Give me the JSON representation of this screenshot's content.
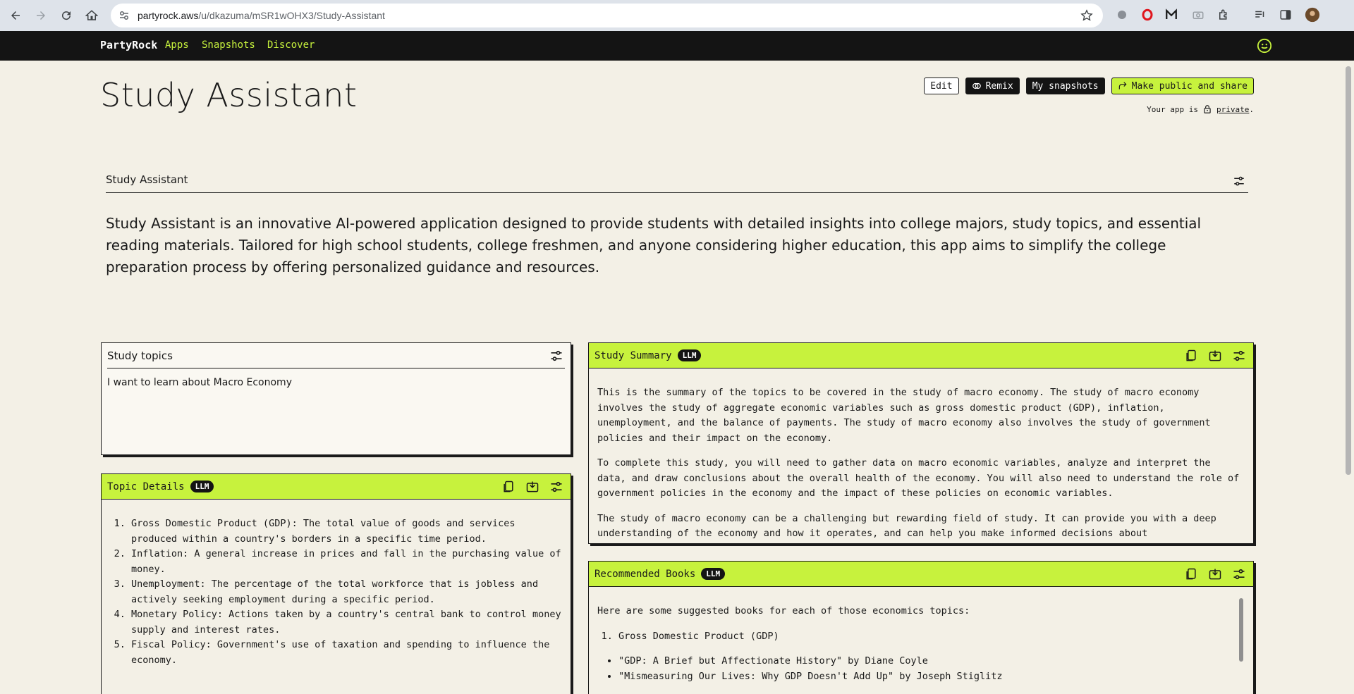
{
  "browser": {
    "url_host": "partyrock.aws",
    "url_path": "/u/dkazuma/mSR1wOHX3/Study-Assistant"
  },
  "nav": {
    "brand": "PartyRock",
    "links": [
      "Apps",
      "Snapshots",
      "Discover"
    ]
  },
  "app": {
    "title": "Study Assistant",
    "actions": {
      "edit": "Edit",
      "remix": "Remix",
      "snapshots": "My snapshots",
      "share": "Make public and share"
    },
    "privacy": {
      "prefix": "Your app is",
      "status": "private",
      "suffix": "."
    }
  },
  "description": {
    "label": "Study Assistant",
    "text": "Study Assistant is an innovative AI-powered application designed to provide students with detailed insights into college majors, study topics, and essential reading materials. Tailored for high school students, college freshmen, and anyone considering higher education, this app aims to simplify the college preparation process by offering personalized guidance and resources."
  },
  "widgets": {
    "study_topics": {
      "label": "Study topics",
      "value": "I want to learn about Macro Economy"
    },
    "topic_details": {
      "label": "Topic Details",
      "badge": "LLM",
      "items": [
        "Gross Domestic Product (GDP): The total value of goods and services produced within a country's borders in a specific time period.",
        "Inflation: A general increase in prices and fall in the purchasing value of money.",
        "Unemployment: The percentage of the total workforce that is jobless and actively seeking employment during a specific period.",
        "Monetary Policy: Actions taken by a country's central bank to control money supply and interest rates.",
        "Fiscal Policy: Government's use of taxation and spending to influence the economy."
      ]
    },
    "study_summary": {
      "label": "Study Summary",
      "badge": "LLM",
      "paragraphs": [
        "This is the summary of the topics to be covered in the study of macro economy. The study of macro economy involves the study of aggregate economic variables such as gross domestic product (GDP), inflation, unemployment, and the balance of payments. The study of macro economy also involves the study of government policies and their impact on the economy.",
        "To complete this study, you will need to gather data on macro economic variables, analyze and interpret the data, and draw conclusions about the overall health of the economy. You will also need to understand the role of government policies in the economy and the impact of these policies on economic variables.",
        "The study of macro economy can be a challenging but rewarding field of study. It can provide you with a deep understanding of the economy and how it operates, and can help you make informed decisions about"
      ]
    },
    "recommended_books": {
      "label": "Recommended Books",
      "badge": "LLM",
      "intro": "Here are some suggested books for each of those economics topics:",
      "topic": "Gross Domestic Product (GDP)",
      "books": [
        "\"GDP: A Brief but Affectionate History\" by Diane Coyle",
        "\"Mismeasuring Our Lives: Why GDP Doesn't Add Up\" by Joseph Stiglitz"
      ]
    }
  },
  "colors": {
    "accent": "#c7f23d",
    "background": "#f3f0e6",
    "dark": "#141414"
  }
}
